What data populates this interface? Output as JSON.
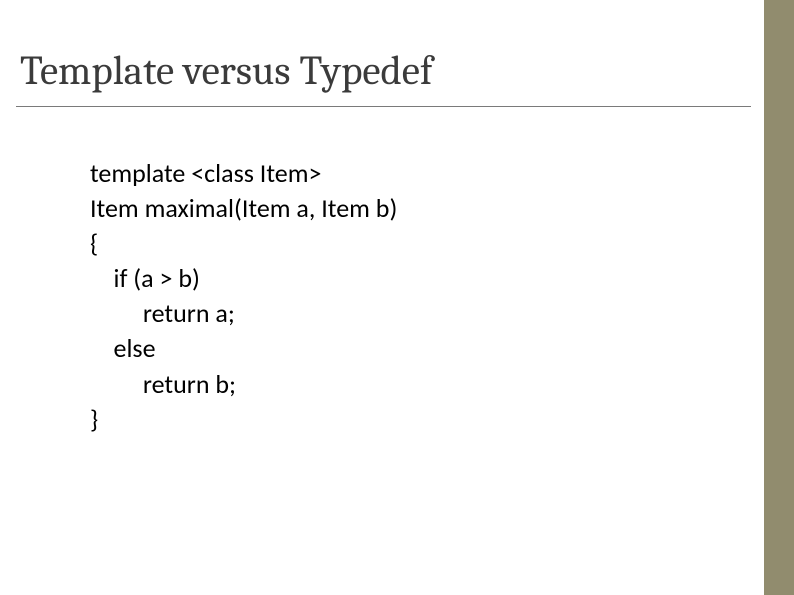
{
  "title": "Template versus Typedef",
  "code": {
    "l1": "template <class Item>",
    "l2": "Item maximal(Item a, Item b)",
    "l3": "{",
    "l4": "    if (a > b)",
    "l5": "         return a;",
    "l6": "    else",
    "l7": "         return b;",
    "l8": "}"
  }
}
